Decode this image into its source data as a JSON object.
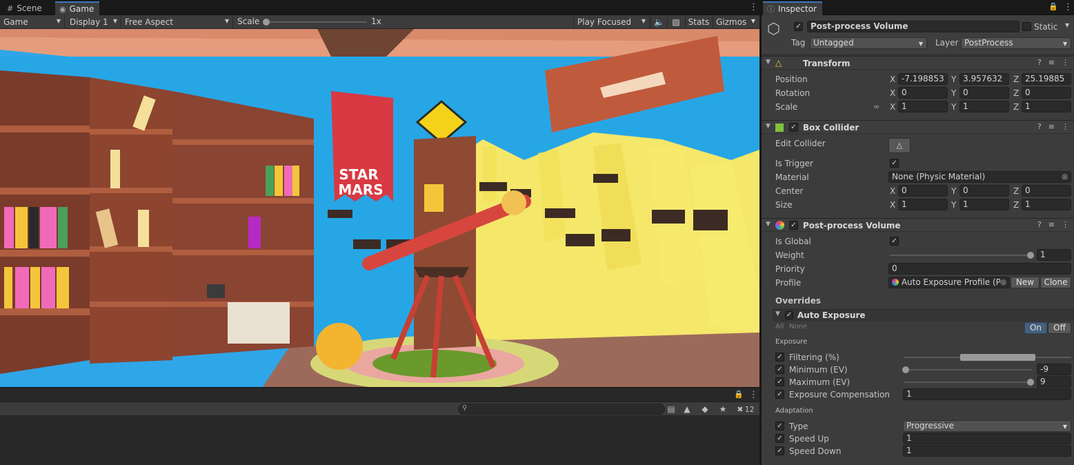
{
  "game_panel": {
    "tabs": [
      {
        "label": "Scene",
        "icon": "grid-icon"
      },
      {
        "label": "Game",
        "icon": "gamepad-icon"
      }
    ],
    "toolbar": {
      "view_mode": "Game",
      "display": "Display 1",
      "aspect": "Free Aspect",
      "scale_label": "Scale",
      "scale_value": "1x",
      "play_mode": "Play Focused",
      "stats_label": "Stats",
      "gizmos_label": "Gizmos"
    },
    "scene_text": {
      "banner_line1": "STAR",
      "banner_line2": "MARS"
    }
  },
  "console": {
    "search_placeholder": "",
    "hidden_count": "12"
  },
  "inspector": {
    "tab_label": "Inspector",
    "object": {
      "enabled": true,
      "name": "Post-process Volume",
      "static_label": "Static",
      "tag_label": "Tag",
      "tag_value": "Untagged",
      "layer_label": "Layer",
      "layer_value": "PostProcess"
    },
    "transform": {
      "title": "Transform",
      "position_label": "Position",
      "position": {
        "x": "-7.198853",
        "y": "3.957632",
        "z": "25.19885"
      },
      "rotation_label": "Rotation",
      "rotation": {
        "x": "0",
        "y": "0",
        "z": "0"
      },
      "scale_label": "Scale",
      "scale": {
        "x": "1",
        "y": "1",
        "z": "1"
      }
    },
    "box_collider": {
      "title": "Box Collider",
      "edit_collider_label": "Edit Collider",
      "is_trigger_label": "Is Trigger",
      "material_label": "Material",
      "material_value": "None (Physic Material)",
      "center_label": "Center",
      "center": {
        "x": "0",
        "y": "0",
        "z": "0"
      },
      "size_label": "Size",
      "size": {
        "x": "1",
        "y": "1",
        "z": "1"
      }
    },
    "post_process_volume": {
      "title": "Post-process Volume",
      "is_global_label": "Is Global",
      "weight_label": "Weight",
      "weight_value": "1",
      "weight_fraction": 1.0,
      "priority_label": "Priority",
      "priority_value": "0",
      "profile_label": "Profile",
      "profile_value": "Auto Exposure Profile (Po",
      "new_label": "New",
      "clone_label": "Clone",
      "overrides_label": "Overrides",
      "auto_exposure": {
        "title": "Auto Exposure",
        "all_label": "All",
        "none_label": "None",
        "on_label": "On",
        "off_label": "Off",
        "exposure_section": "Exposure",
        "filtering_label": "Filtering (%)",
        "filtering_range": [
          0.5,
          0.95
        ],
        "minimum_label": "Minimum (EV)",
        "minimum_value": "-9",
        "maximum_label": "Maximum (EV)",
        "maximum_value": "9",
        "exposure_comp_label": "Exposure Compensation",
        "exposure_comp_value": "1",
        "adaptation_section": "Adaptation",
        "type_label": "Type",
        "type_value": "Progressive",
        "speed_up_label": "Speed Up",
        "speed_up_value": "1",
        "speed_down_label": "Speed Down",
        "speed_down_value": "1"
      }
    }
  }
}
